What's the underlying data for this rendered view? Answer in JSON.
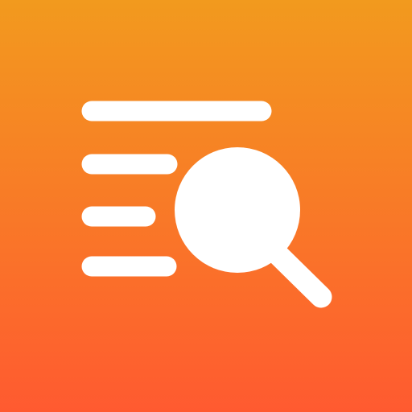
{
  "icon": {
    "name": "list-search-icon",
    "colors": {
      "gradient_top": "#F29A1E",
      "gradient_bottom": "#FF5A30",
      "glyph": "#FFFFFF"
    }
  }
}
